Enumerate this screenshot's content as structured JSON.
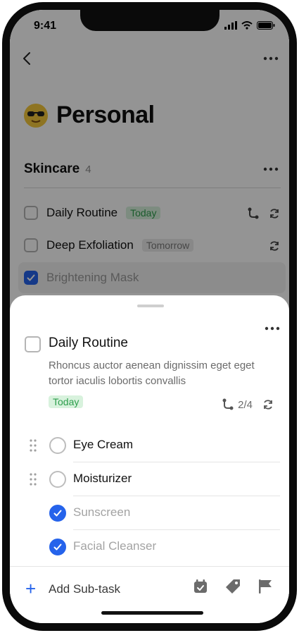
{
  "status": {
    "time": "9:41"
  },
  "header": {
    "title": "Personal"
  },
  "section": {
    "name": "Skincare",
    "count": "4"
  },
  "tasks": [
    {
      "label": "Daily Routine",
      "tag": "Today"
    },
    {
      "label": "Deep Exfoliation",
      "tag": "Tomorrow"
    },
    {
      "label": "Brightening Mask"
    }
  ],
  "sheet": {
    "title": "Daily Routine",
    "description": "Rhoncus auctor aenean dignissim eget eget tortor iaculis lobortis convallis",
    "tag": "Today",
    "progress": "2/4",
    "subtasks": [
      {
        "label": "Eye Cream",
        "done": false
      },
      {
        "label": "Moisturizer",
        "done": false
      },
      {
        "label": "Sunscreen",
        "done": true
      },
      {
        "label": "Facial Cleanser",
        "done": true
      }
    ],
    "add_label": "Add Sub-task"
  },
  "colors": {
    "accent": "#2563eb",
    "today_green": "#2e9e4d"
  }
}
